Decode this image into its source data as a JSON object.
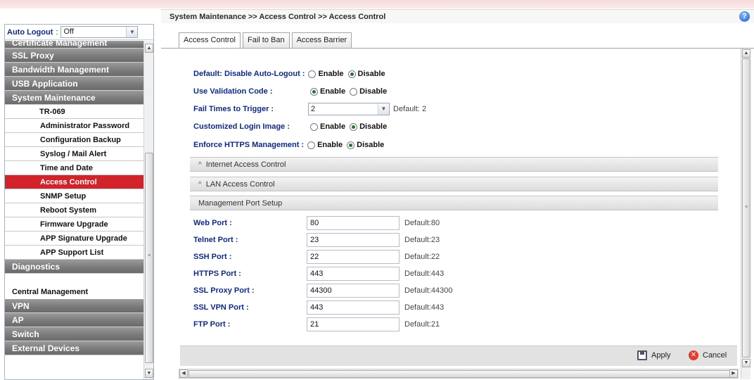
{
  "breadcrumb": "System Maintenance >> Access Control >> Access Control",
  "help_label": "?",
  "sidebar": {
    "autologout_label": "Auto Logout",
    "autologout_colon": ":",
    "autologout_value": "Off",
    "items": [
      {
        "label": "Certificate Management",
        "type": "category-partial"
      },
      {
        "label": "SSL Proxy",
        "type": "category"
      },
      {
        "label": "Bandwidth Management",
        "type": "category"
      },
      {
        "label": "USB Application",
        "type": "category"
      },
      {
        "label": "System Maintenance",
        "type": "category"
      },
      {
        "label": "TR-069",
        "type": "sub"
      },
      {
        "label": "Administrator Password",
        "type": "sub"
      },
      {
        "label": "Configuration Backup",
        "type": "sub"
      },
      {
        "label": "Syslog / Mail Alert",
        "type": "sub"
      },
      {
        "label": "Time and Date",
        "type": "sub"
      },
      {
        "label": "Access Control",
        "type": "sub-active"
      },
      {
        "label": "SNMP Setup",
        "type": "sub"
      },
      {
        "label": "Reboot System",
        "type": "sub"
      },
      {
        "label": "Firmware Upgrade",
        "type": "sub"
      },
      {
        "label": "APP Signature Upgrade",
        "type": "sub"
      },
      {
        "label": "APP Support List",
        "type": "sub"
      },
      {
        "label": "Diagnostics",
        "type": "category"
      },
      {
        "label": "Central Management",
        "type": "plain"
      },
      {
        "label": "VPN",
        "type": "category"
      },
      {
        "label": "AP",
        "type": "category"
      },
      {
        "label": "Switch",
        "type": "category"
      },
      {
        "label": "External Devices",
        "type": "category"
      }
    ]
  },
  "tabs": [
    "Access Control",
    "Fail to Ban",
    "Access Barrier"
  ],
  "settings": {
    "auto_logout": {
      "label": "Default: Disable Auto-Logout :",
      "enable": "Enable",
      "disable": "Disable",
      "selected": "disable"
    },
    "validation_code": {
      "label": "Use Validation Code :",
      "enable": "Enable",
      "disable": "Disable",
      "selected": "enable"
    },
    "fail_times": {
      "label": "Fail Times to Trigger :",
      "value": "2",
      "default": "Default: 2"
    },
    "login_image": {
      "label": "Customized Login Image :",
      "enable": "Enable",
      "disable": "Disable",
      "selected": "disable"
    },
    "https_mgmt": {
      "label": "Enforce HTTPS Management :",
      "enable": "Enable",
      "disable": "Disable",
      "selected": "disable"
    }
  },
  "sections": {
    "internet": "Internet Access Control",
    "lan": "LAN Access Control",
    "mgmt_port": "Management Port Setup",
    "chevron": "^"
  },
  "ports": [
    {
      "label": "Web Port :",
      "value": "80",
      "default": "Default:80"
    },
    {
      "label": "Telnet Port :",
      "value": "23",
      "default": "Default:23"
    },
    {
      "label": "SSH Port :",
      "value": "22",
      "default": "Default:22"
    },
    {
      "label": "HTTPS Port :",
      "value": "443",
      "default": "Default:443"
    },
    {
      "label": "SSL Proxy Port :",
      "value": "44300",
      "default": "Default:44300"
    },
    {
      "label": "SSL VPN Port :",
      "value": "443",
      "default": "Default:443"
    },
    {
      "label": "FTP Port :",
      "value": "21",
      "default": "Default:21"
    }
  ],
  "footer": {
    "apply": "Apply",
    "cancel": "Cancel"
  },
  "icons": {
    "help": "help-icon",
    "apply": "save-icon",
    "cancel": "cancel-icon"
  },
  "colors": {
    "accent_red": "#d3232a",
    "label_blue": "#0f2a86"
  }
}
